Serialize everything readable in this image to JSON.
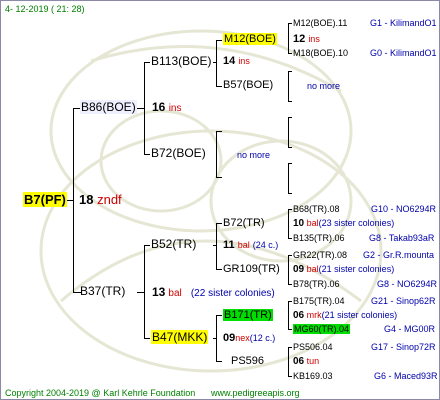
{
  "header": {
    "date": "4- 12-2019 ( 21: 28)"
  },
  "footer": {
    "copyright": "Copyright 2004-2019 @ Karl Kehrle Foundation",
    "site": "www.pedigreeapis.org"
  },
  "gen1": {
    "queen": "B7(PF)",
    "line_number": "18",
    "line_note": "zndf"
  },
  "gen2": [
    {
      "name": "B86(BOE)",
      "number": "16",
      "note": "ins"
    },
    {
      "name": "B37(TR)",
      "number": "13",
      "note": "bal",
      "extra": "(22 sister colonies)"
    }
  ],
  "gen3": [
    {
      "name": "B113(BOE)",
      "number": "14",
      "note": "ins"
    },
    {
      "name": "B72(BOE)",
      "note": "no more"
    },
    {
      "name": "B52(TR)",
      "number": "11",
      "note": "bal",
      "extra": "(24 c.)"
    },
    {
      "name": "B47(MKK)",
      "number": "09",
      "note": "nex",
      "extra": "(12 c.)"
    }
  ],
  "gen4": [
    {
      "name": "M12(BOE)",
      "number": "12",
      "note": "ins"
    },
    {
      "name": "B57(BOE)",
      "note": "no more"
    },
    {
      "name": "B72(TR)",
      "number": "10",
      "note": "bal",
      "extra": "(23 sister colonies)"
    },
    {
      "name": "GR109(TR)",
      "number": "09",
      "note": "bal",
      "extra": "(21 sister colonies)"
    },
    {
      "name": "B171(TR)",
      "number": "06",
      "note": "mrk",
      "extra": "(21 sister colonies)"
    },
    {
      "name": "PS596",
      "number": "06",
      "note": "tun"
    }
  ],
  "gen5": [
    {
      "name": "M12(BOE).11",
      "info": "G1 - KilimandO1"
    },
    {
      "name": "M18(BOE).10",
      "info": "G0 - KilimandO1"
    },
    {
      "name": "B68(TR).08",
      "info": "G10 - NO6294R"
    },
    {
      "name": "B135(TR).06",
      "info": "G8 - Takab93aR"
    },
    {
      "name": "GR22(TR).08",
      "info": "G2 - Gr.R.mounta"
    },
    {
      "name": "B78(TR).06",
      "info": "G8 - NO6294R"
    },
    {
      "name": "B175(TR).04",
      "info": "G21 - Sinop62R"
    },
    {
      "name": "MG60(TR).04",
      "info": "G4 - MG00R"
    },
    {
      "name": "PS506.04",
      "info": "G17 - Sinop72R"
    },
    {
      "name": "KB169.03",
      "info": "G6 - Maced93R"
    }
  ],
  "colors": {
    "blue": "#0000aa",
    "red": "#cc0000",
    "green": "#008000",
    "highlight_yellow": "#ffff00",
    "highlight_green": "#00dd00"
  }
}
